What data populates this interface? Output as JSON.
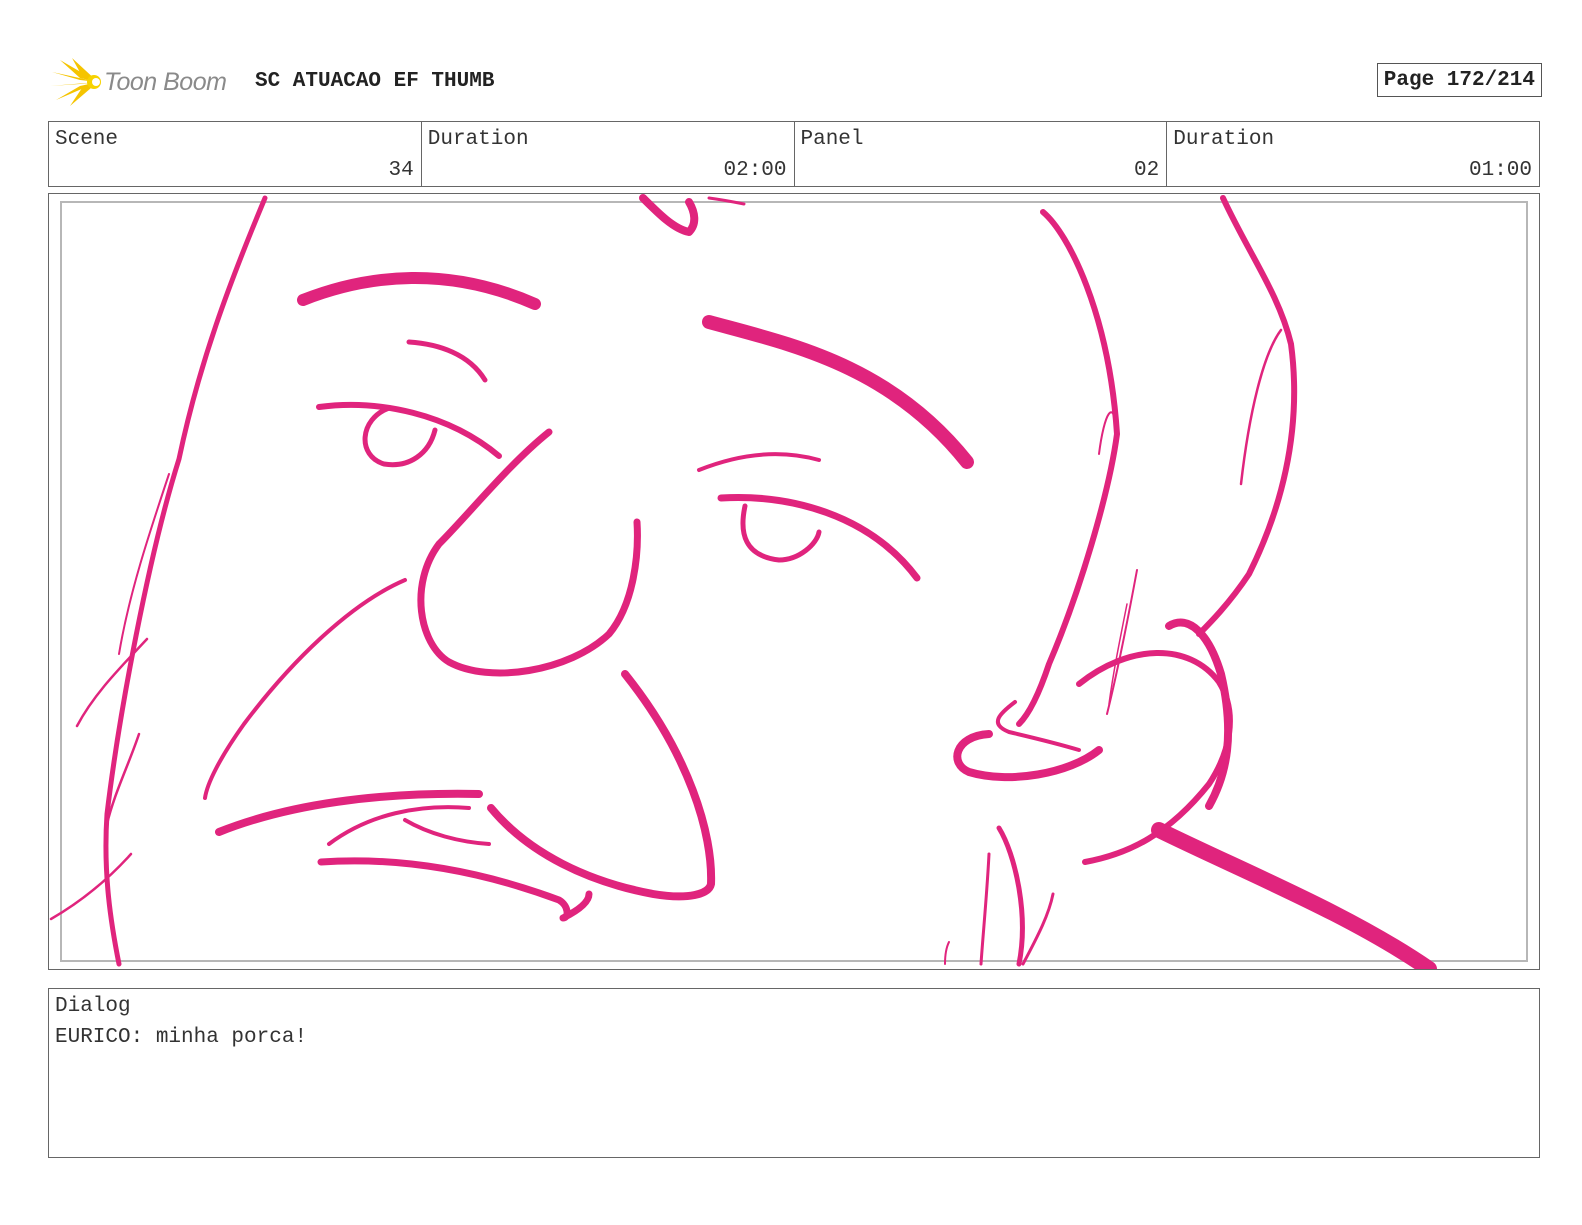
{
  "header": {
    "logo_text": "Toon Boom",
    "project_title": "SC ATUACAO EF THUMB",
    "page_label": "Page 172/214"
  },
  "info": {
    "scene_label": "Scene",
    "scene_value": "34",
    "scene_duration_label": "Duration",
    "scene_duration_value": "02:00",
    "panel_label": "Panel",
    "panel_value": "02",
    "panel_duration_label": "Duration",
    "panel_duration_value": "01:00"
  },
  "dialog": {
    "label": "Dialog",
    "text": "EURICO: minha porca!"
  },
  "colors": {
    "sketch_stroke": "#e0247d",
    "logo_star": "#f5c400",
    "border": "#666666"
  }
}
